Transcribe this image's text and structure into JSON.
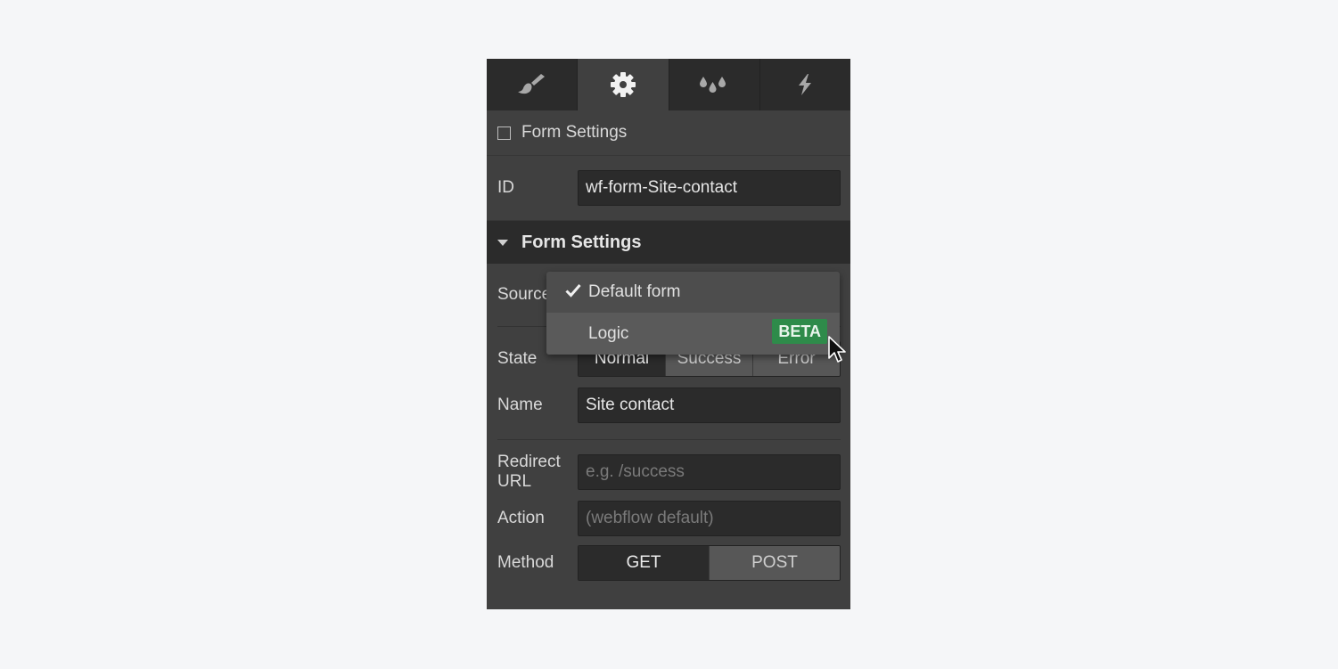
{
  "tabs": [
    {
      "icon": "paintbrush-icon",
      "active": false
    },
    {
      "icon": "gear-icon",
      "active": true
    },
    {
      "icon": "droplets-icon",
      "active": false
    },
    {
      "icon": "lightning-icon",
      "active": false
    }
  ],
  "form_block": {
    "checkbox_label": "Form Settings",
    "checked": false,
    "id_label": "ID",
    "id_value": "wf-form-Site-contact"
  },
  "form_settings": {
    "section_title": "Form Settings",
    "source_label": "Source",
    "source_dropdown": {
      "options": [
        {
          "label": "Default form",
          "selected": true
        },
        {
          "label": "Logic",
          "badge": "BETA",
          "hovered": true
        }
      ]
    },
    "state_label": "State",
    "state_options": [
      "Normal",
      "Success",
      "Error"
    ],
    "state_selected": "Normal",
    "name_label": "Name",
    "name_value": "Site contact",
    "redirect_label": "Redirect URL",
    "redirect_placeholder": "e.g. /success",
    "action_label": "Action",
    "action_placeholder": "(webflow default)",
    "method_label": "Method",
    "method_options": [
      "GET",
      "POST"
    ],
    "method_selected": "GET"
  },
  "colors": {
    "panel_bg": "#404040",
    "tab_bg": "#2b2b2b",
    "beta_badge": "#2e8b4a"
  }
}
